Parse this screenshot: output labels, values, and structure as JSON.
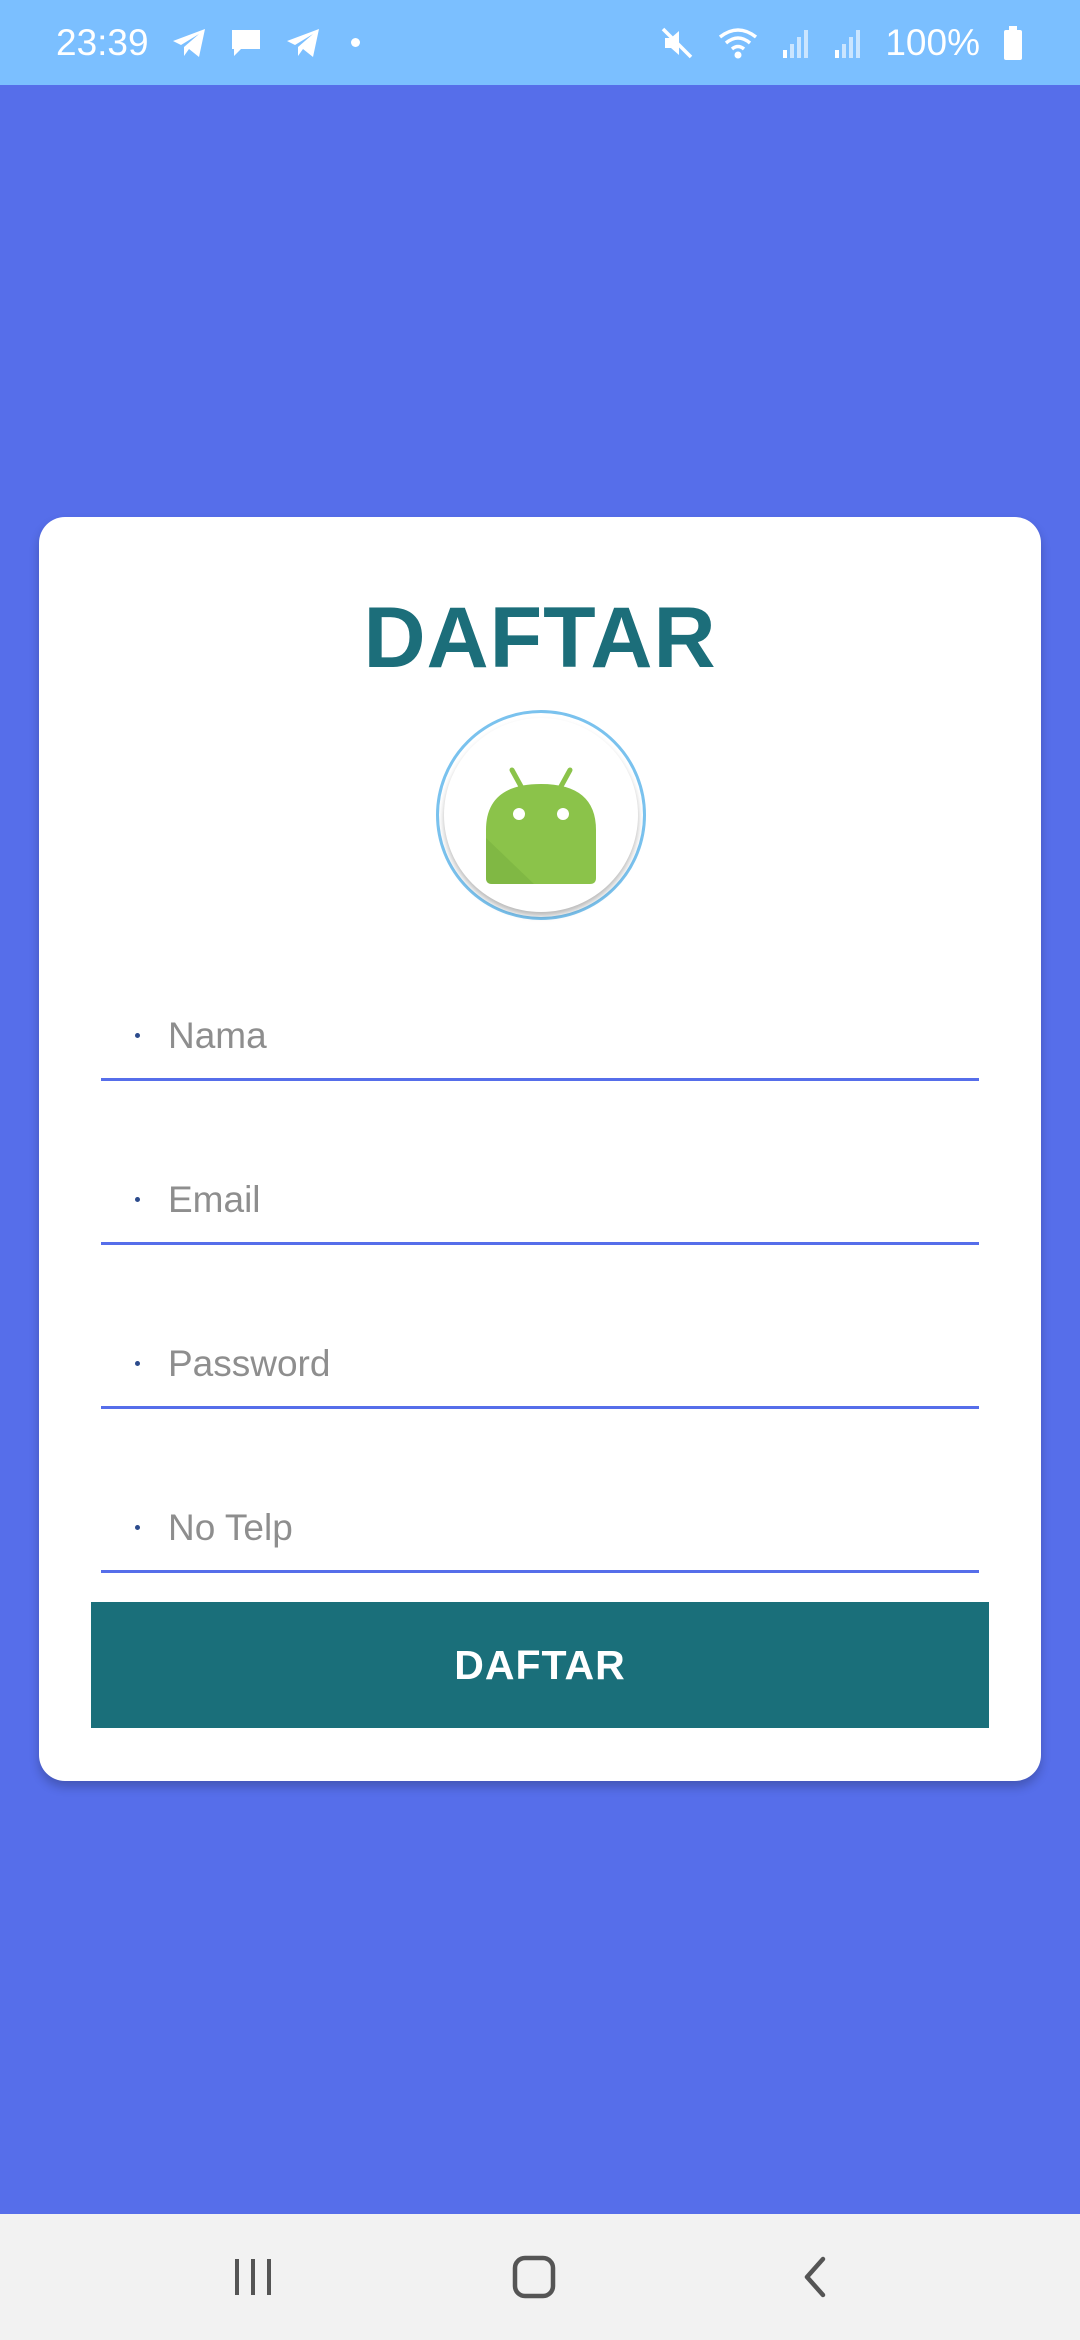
{
  "status_bar": {
    "time": "23:39",
    "battery": "100%",
    "icons_left": [
      "telegram-icon",
      "message-icon",
      "telegram-icon",
      "dot-icon"
    ],
    "icons_right": [
      "mute-icon",
      "wifi-icon",
      "signal-icon",
      "signal-icon",
      "battery-icon"
    ]
  },
  "form": {
    "title": "DAFTAR",
    "avatar_icon": "android-icon",
    "fields": [
      {
        "placeholder": "Nama",
        "value": ""
      },
      {
        "placeholder": "Email",
        "value": ""
      },
      {
        "placeholder": "Password",
        "value": ""
      },
      {
        "placeholder": "No Telp",
        "value": ""
      }
    ],
    "submit_label": "DAFTAR"
  },
  "nav_bar": {
    "buttons": [
      "recents-icon",
      "home-icon",
      "back-icon"
    ]
  },
  "colors": {
    "background": "#566EEA",
    "status_bar": "#7BBFFF",
    "accent": "#1A6F7A",
    "title": "#1C6E7A",
    "underline": "#566EEA"
  }
}
